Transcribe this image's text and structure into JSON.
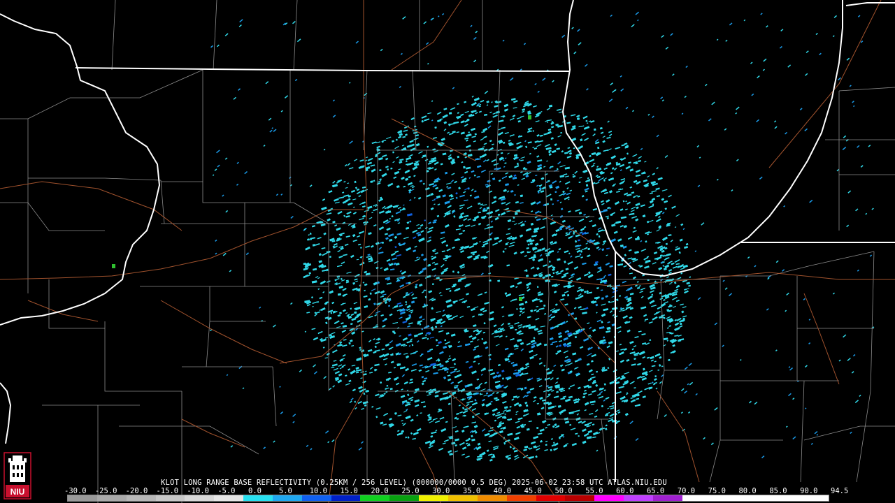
{
  "radar": {
    "caption": "KLOT LONG RANGE BASE REFLECTIVITY (0.25KM / 256 LEVEL) (000000/0000 0.5 DEG) 2025-06-02 23:58 UTC  ATLAS.NIU.EDU",
    "scale_labels": [
      "-30.0",
      "-25.0",
      "-20.0",
      "-15.0",
      "-10.0",
      "-5.0",
      "0.0",
      "5.0",
      "10.0",
      "15.0",
      "20.0",
      "25.0",
      "30.0",
      "35.0",
      "40.0",
      "45.0",
      "50.0",
      "55.0",
      "60.0",
      "65.0",
      "70.0",
      "75.0",
      "80.0",
      "85.0",
      "90.0",
      "94.5"
    ],
    "scale_colors": [
      "#9a9a9a",
      "#aaaaaa",
      "#b8b8b8",
      "#c8c8c8",
      "#d8d8d8",
      "#e6e6e6",
      "#28e0f0",
      "#20a8f0",
      "#1060f0",
      "#0020c8",
      "#10d020",
      "#08a010",
      "#f0f000",
      "#f0c000",
      "#f08c00",
      "#f04000",
      "#e00000",
      "#b80000",
      "#ff00ff",
      "#c040ff",
      "#a020d0",
      "#ffffff",
      "#ffffff",
      "#ffffff",
      "#ffffff",
      "#ffffff"
    ],
    "colors": {
      "background": "#000000",
      "state_border": "#ffffff",
      "county_border": "#8c8c8c",
      "highway": "#a0522d",
      "echo_light": "#30d8e8",
      "echo_medium": "#1a9ae8",
      "echo_strong": "#1060e0",
      "echo_green": "#30c030"
    },
    "logo": {
      "text": "NIU",
      "icon": "university-tower-logo-icon",
      "colors": {
        "tower": "#ffffff",
        "base": "#c8102e"
      }
    }
  }
}
